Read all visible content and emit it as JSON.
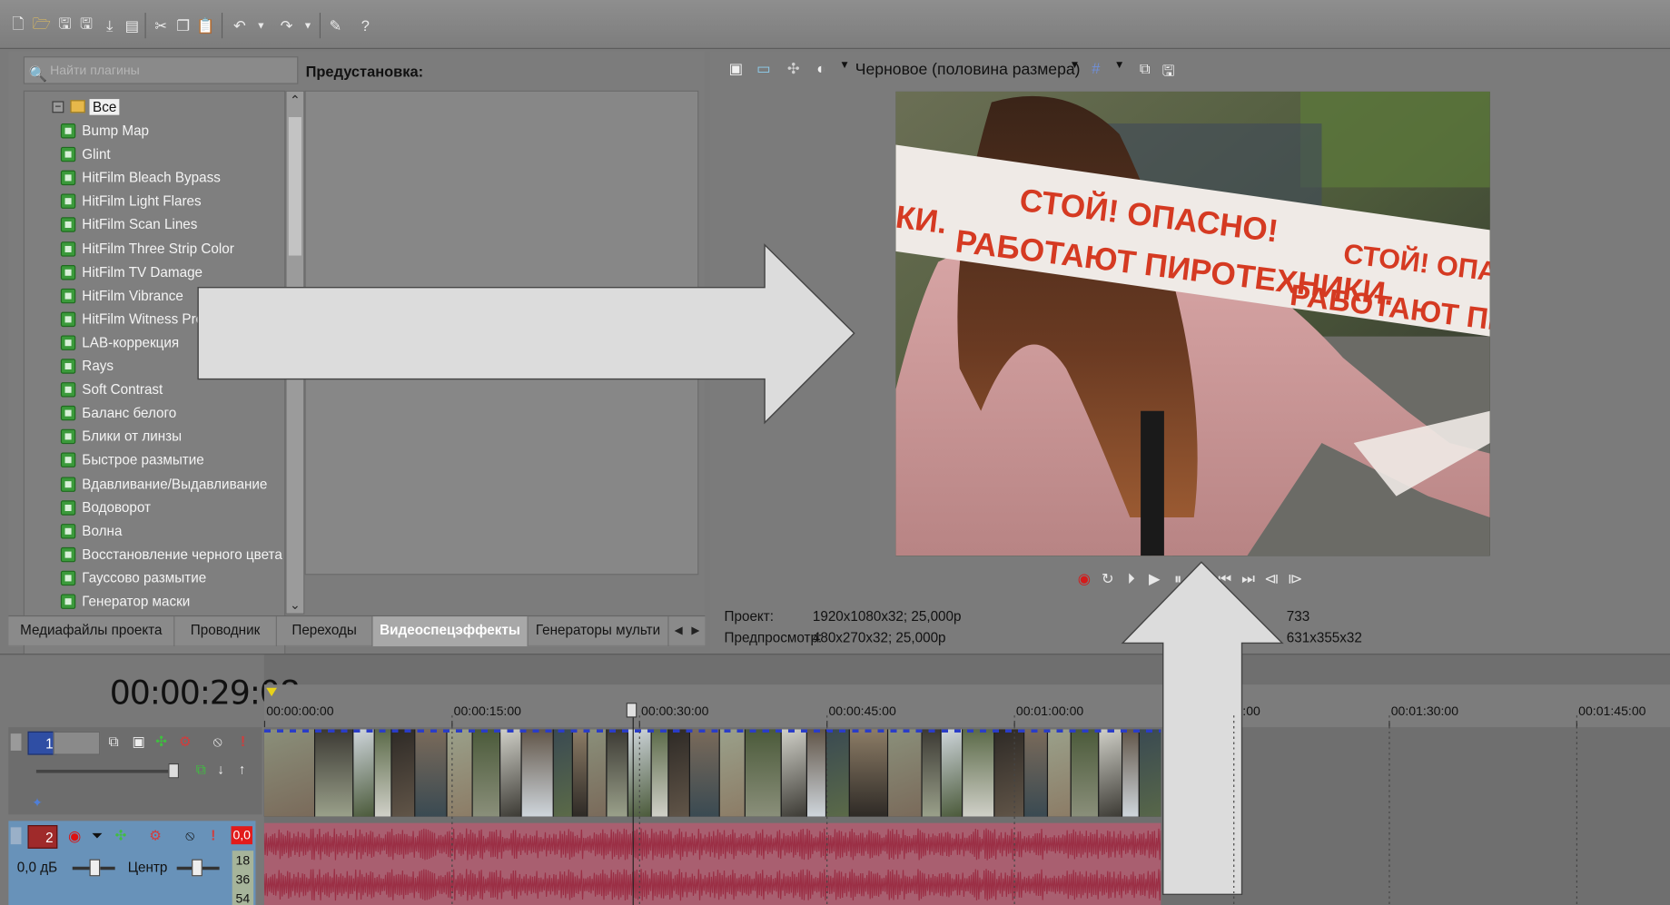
{
  "toolbar": {
    "icons": [
      "new-file-icon",
      "open-folder-icon",
      "save-icon",
      "save-as-icon",
      "render-icon",
      "properties-icon",
      "cut-icon",
      "copy-icon",
      "paste-icon",
      "undo-icon",
      "redo-icon",
      "help-icon",
      "whats-this-icon"
    ]
  },
  "plugins": {
    "search_placeholder": "Найти плагины",
    "root_label": "Все",
    "items": [
      "Bump Map",
      "Glint",
      "HitFilm Bleach Bypass",
      "HitFilm Light Flares",
      "HitFilm Scan Lines",
      "HitFilm Three Strip Color",
      "HitFilm TV Damage",
      "HitFilm Vibrance",
      "HitFilm Witness Prote",
      "LAB-коррекция",
      "Rays",
      "Soft Contrast",
      "Баланс белого",
      "Блики от линзы",
      "Быстрое размытие",
      "Вдавливание/Выдавливание",
      "Водоворот",
      "Волна",
      "Восстановление черного цвета",
      "Гауссово размытие",
      "Генератор маски"
    ]
  },
  "preset": {
    "label": "Предустановка:"
  },
  "tabs": [
    {
      "label": "Медиафайлы проекта",
      "active": false
    },
    {
      "label": "Проводник",
      "active": false
    },
    {
      "label": "Переходы",
      "active": false
    },
    {
      "label": "Видеоспецэффекты",
      "active": true
    },
    {
      "label": "Генераторы мульти",
      "active": false
    }
  ],
  "preview": {
    "quality": "Черновое (половина размера)",
    "video_text_line1": "СТОЙ!  ОПАСНО!",
    "video_text_line2": "РАБОТАЮТ ПИРОТЕХНИКИ.",
    "video_text_left": "КИ.",
    "video_text_right1": "СТОЙ!  ОПАСНО",
    "video_text_right2": "РАБОТАЮТ ПИРОТЕХ",
    "project_label": "Проект:",
    "project_value": "1920x1080x32; 25,000p",
    "preview_label": "Предпросмотр:",
    "preview_value": "480x270x32; 25,000p",
    "frame_value": "733",
    "display_value": "631x355x32"
  },
  "timeline": {
    "timecode": "00:00:29:08",
    "ticks": [
      "00:00:00:00",
      "00:00:15:00",
      "00:00:30:00",
      "00:00:45:00",
      "00:01:00:00",
      "5:00",
      "00:01:30:00",
      "00:01:45:00"
    ],
    "video_track_number": "1",
    "audio_track_number": "2",
    "audio_volume": "0,0 дБ",
    "audio_pan": "Центр",
    "audio_peak": "0,0",
    "meter_values": [
      "18",
      "36",
      "54"
    ]
  },
  "colors": {
    "accent_red": "#e21b1b",
    "audio_waveform": "#9b2f45",
    "audio_track_header": "#6892b9",
    "arrow_fill": "#dcdcdc"
  }
}
